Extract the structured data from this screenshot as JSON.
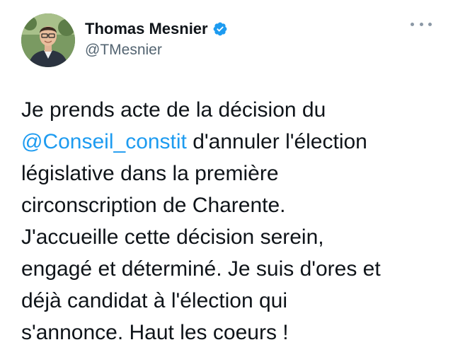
{
  "author": {
    "display_name": "Thomas Mesnier",
    "handle": "@TMesnier",
    "verified_icon": "verified-badge-icon"
  },
  "menu": {
    "icon": "more-options-icon"
  },
  "tweet": {
    "line1": "Je prends acte de la décision du",
    "mention": "@Conseil_constit",
    "line2_rest": " d'annuler l'élection",
    "line3": "législative dans la première",
    "line4": "circonscription de Charente.",
    "line5": "J'accueille cette décision serein,",
    "line6": "engagé et déterminé. Je suis d'ores et",
    "line7": "déjà candidat à l'élection qui",
    "line8": "s'annonce. Haut les coeurs !"
  },
  "colors": {
    "link": "#1d9bf0",
    "text": "#0f1419",
    "secondary": "#536471",
    "verified": "#1d9bf0"
  }
}
